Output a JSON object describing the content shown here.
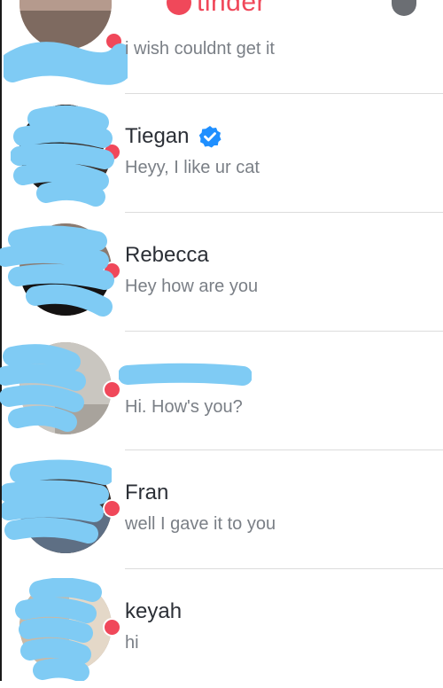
{
  "app": {
    "logo_text": "tinder"
  },
  "colors": {
    "brand": "#f0485a",
    "verified": "#1f8fff",
    "redaction": "#7fcbf4"
  },
  "conversations": [
    {
      "name": "",
      "preview": "i wish couldnt get it",
      "unread": true,
      "verified": false,
      "name_redacted": true
    },
    {
      "name": "Tiegan",
      "preview": "Heyy, I like ur cat",
      "unread": true,
      "verified": true,
      "name_redacted": false
    },
    {
      "name": "Rebecca",
      "preview": "Hey how are you",
      "unread": true,
      "verified": false,
      "name_redacted": false
    },
    {
      "name": "",
      "preview": "Hi. How's you?",
      "unread": true,
      "verified": false,
      "name_redacted": true
    },
    {
      "name": "Fran",
      "preview": "well I gave it to you",
      "unread": true,
      "verified": false,
      "name_redacted": false
    },
    {
      "name": "keyah",
      "preview": "hi",
      "unread": true,
      "verified": false,
      "name_redacted": false
    }
  ]
}
